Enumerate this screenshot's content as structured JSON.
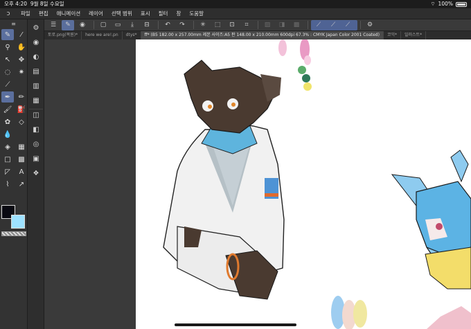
{
  "status": {
    "time": "오후 4:20",
    "date": "9월 8일 수요일",
    "battery": "100%"
  },
  "menu": {
    "items": [
      "파일",
      "편집",
      "애니메이션",
      "레이어",
      "선택 범위",
      "표시",
      "필터",
      "창",
      "도움말"
    ]
  },
  "tabs": [
    {
      "label": "토로.png(복원)*",
      "active": false
    },
    {
      "label": "here we are!.pn",
      "active": false
    },
    {
      "label": "dtys*",
      "active": false
    },
    {
      "label": "ff* (B5 182.00 x 257.00mm 제본 사이즈:A5 판 148.00 x 210.00mm 600dpi 67.3% : CMYK Japan Color 2001 Coated)",
      "active": true
    },
    {
      "label": "코익*",
      "active": false
    },
    {
      "label": "일러스트*",
      "active": false
    }
  ],
  "colors": {
    "main": "#0a0a12",
    "sub": "#9ee2ff",
    "accent": "#5b6f9e"
  },
  "icons": {
    "tools": [
      "zoom",
      "hand",
      "rotate",
      "move",
      "lasso",
      "magic-wand",
      "eyedropper",
      "pen",
      "pencil",
      "brush",
      "airbrush",
      "decoration",
      "eraser",
      "blend",
      "fill",
      "gradient",
      "figure",
      "frame",
      "ruler",
      "text",
      "balloon",
      "correct-line"
    ],
    "commands": [
      "menu",
      "new",
      "open",
      "save",
      "undo",
      "redo",
      "fill",
      "selection",
      "ruler",
      "snap"
    ]
  }
}
